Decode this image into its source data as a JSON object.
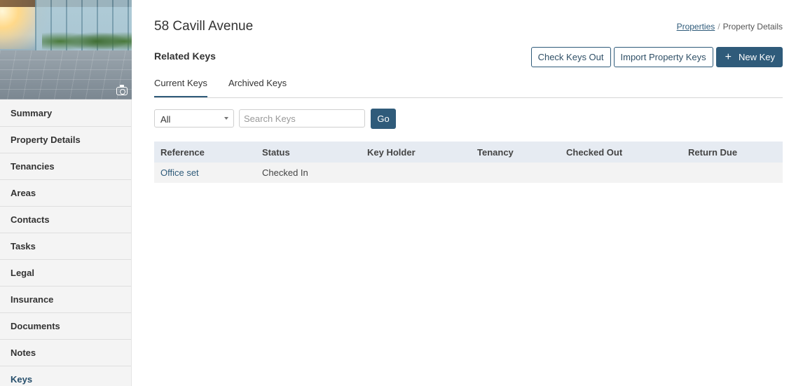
{
  "sidebar": {
    "photo_icon": "camera-icon",
    "items": [
      {
        "label": "Summary"
      },
      {
        "label": "Property Details"
      },
      {
        "label": "Tenancies"
      },
      {
        "label": "Areas"
      },
      {
        "label": "Contacts"
      },
      {
        "label": "Tasks"
      },
      {
        "label": "Legal"
      },
      {
        "label": "Insurance"
      },
      {
        "label": "Documents"
      },
      {
        "label": "Notes"
      },
      {
        "label": "Keys"
      }
    ]
  },
  "header": {
    "title": "58 Cavill Avenue",
    "breadcrumb": {
      "link": "Properties",
      "separator": "/",
      "current": "Property Details"
    }
  },
  "section": {
    "title": "Related Keys"
  },
  "actions": {
    "check_out": "Check Keys Out",
    "import": "Import Property Keys",
    "new_key_icon": "+",
    "new_key": "New Key"
  },
  "tabs": [
    {
      "label": "Current Keys",
      "active": true
    },
    {
      "label": "Archived Keys",
      "active": false
    }
  ],
  "filter": {
    "selected": "All"
  },
  "search": {
    "placeholder": "Search Keys",
    "value": ""
  },
  "go_label": "Go",
  "table": {
    "columns": [
      "Reference",
      "Status",
      "Key Holder",
      "Tenancy",
      "Checked Out",
      "Return Due"
    ],
    "rows": [
      [
        "Office set",
        "Checked In",
        "",
        "",
        "",
        ""
      ]
    ]
  },
  "colors": {
    "accent": "#2f5b7a",
    "header_bg": "#e6ebf2",
    "row_bg": "#f3f3f3"
  }
}
